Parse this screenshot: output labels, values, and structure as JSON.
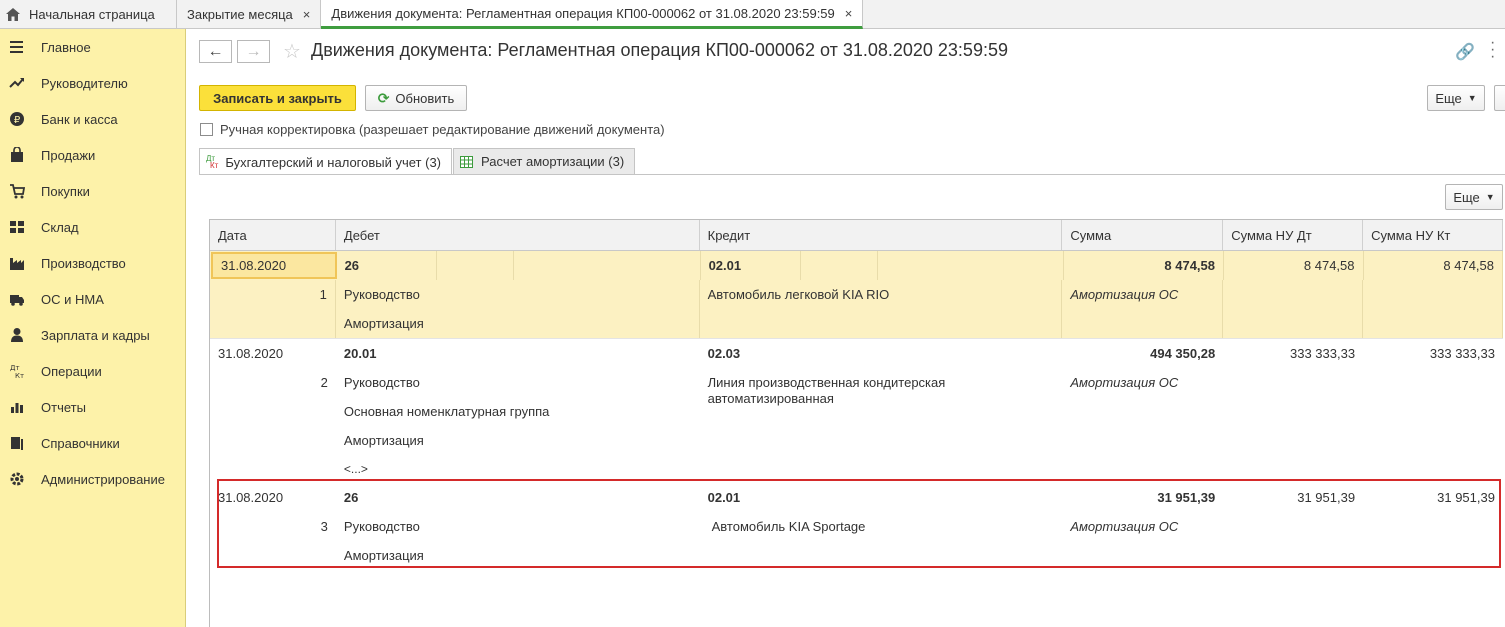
{
  "tabs": [
    {
      "label": "Начальная страница"
    },
    {
      "label": "Закрытие месяца",
      "close": "×"
    },
    {
      "label": "Движения документа: Регламентная операция КП00-000062 от 31.08.2020 23:59:59",
      "close": "×"
    }
  ],
  "sidebar": {
    "items": [
      {
        "label": "Главное",
        "icon": "menu-icon"
      },
      {
        "label": "Руководителю",
        "icon": "trend-icon"
      },
      {
        "label": "Банк и касса",
        "icon": "ruble-icon"
      },
      {
        "label": "Продажи",
        "icon": "bag-icon"
      },
      {
        "label": "Покупки",
        "icon": "cart-icon"
      },
      {
        "label": "Склад",
        "icon": "warehouse-icon"
      },
      {
        "label": "Производство",
        "icon": "factory-icon"
      },
      {
        "label": "ОС и НМА",
        "icon": "truck-icon"
      },
      {
        "label": "Зарплата и кадры",
        "icon": "person-icon"
      },
      {
        "label": "Операции",
        "icon": "dt-kt-icon"
      },
      {
        "label": "Отчеты",
        "icon": "bar-chart-icon"
      },
      {
        "label": "Справочники",
        "icon": "books-icon"
      },
      {
        "label": "Администрирование",
        "icon": "gear-icon"
      }
    ]
  },
  "header": {
    "back": "←",
    "forward": "→",
    "title": "Движения документа: Регламентная операция КП00-000062 от 31.08.2020 23:59:59"
  },
  "toolbar": {
    "save_close": "Записать и закрыть",
    "refresh": "Обновить",
    "more": "Еще",
    "manual_correction": "Ручная корректировка (разрешает редактирование движений документа)"
  },
  "form_tabs": [
    {
      "label": "Бухгалтерский и налоговый учет (3)",
      "icon_top": "Дт",
      "icon_bottom": "Кт"
    },
    {
      "label": "Расчет амортизации (3)"
    }
  ],
  "grid": {
    "more": "Еще",
    "columns": [
      "Дата",
      "Дебет",
      "Кредит",
      "Сумма",
      "Сумма НУ Дт",
      "Сумма НУ Кт"
    ],
    "rows": [
      {
        "date": "31.08.2020",
        "n": "1",
        "debit_account": "26",
        "debit_sub1": "Руководство",
        "debit_sub2": "Амортизация",
        "credit_account": "02.01",
        "credit_sub1": "Автомобиль легковой KIA RIO",
        "sum": "8 474,58",
        "sum_note": "Амортизация ОС",
        "nu_dt": "8 474,58",
        "nu_kt": "8 474,58"
      },
      {
        "date": "31.08.2020",
        "n": "2",
        "debit_account": "20.01",
        "debit_sub1": "Руководство",
        "debit_sub2": "Основная номенклатурная группа",
        "debit_sub3": "Амортизация",
        "debit_more": "<...>",
        "credit_account": "02.03",
        "credit_sub1": "Линия производственная кондитерская автоматизированная",
        "sum": "494 350,28",
        "sum_note": "Амортизация ОС",
        "nu_dt": "333 333,33",
        "nu_kt": "333 333,33"
      },
      {
        "date": "31.08.2020",
        "n": "3",
        "debit_account": "26",
        "debit_sub1": "Руководство",
        "debit_sub2": "Амортизация",
        "credit_account": "02.01",
        "credit_sub1": "Автомобиль KIA Sportage",
        "sum": "31 951,39",
        "sum_note": "Амортизация ОС",
        "nu_dt": "31 951,39",
        "nu_kt": "31 951,39"
      }
    ]
  }
}
